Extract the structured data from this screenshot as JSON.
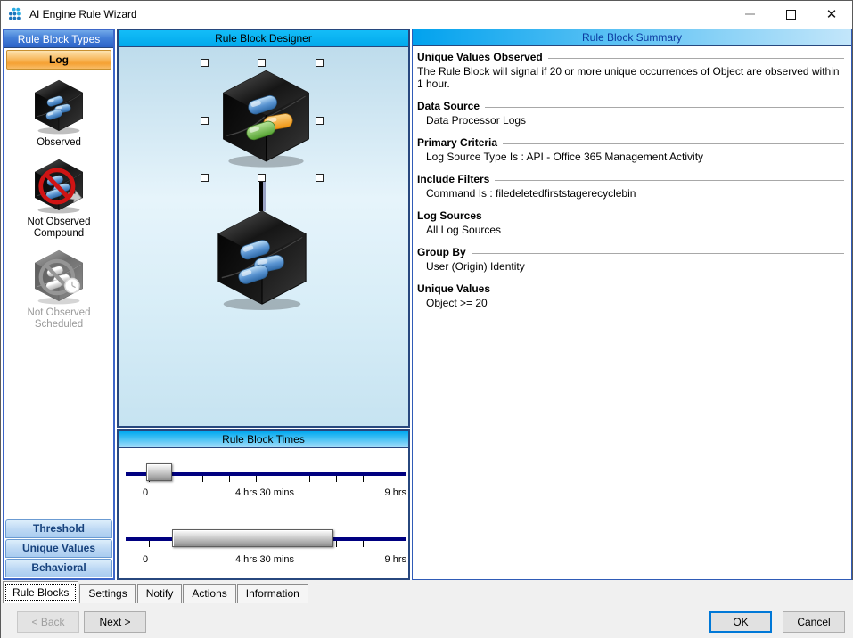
{
  "window": {
    "title": "AI Engine Rule Wizard"
  },
  "left_panel": {
    "header": "Rule Block Types",
    "log_tab": "Log",
    "items": [
      {
        "label": "Observed",
        "icon": "observed-cube-icon",
        "enabled": true
      },
      {
        "label": "Not Observed Compound",
        "icon": "not-observed-compound-cube-icon",
        "enabled": true
      },
      {
        "label": "Not Observed Scheduled",
        "icon": "not-observed-scheduled-cube-icon",
        "enabled": false
      }
    ],
    "bottom_tabs": [
      {
        "label": "Threshold"
      },
      {
        "label": "Unique Values"
      },
      {
        "label": "Behavioral"
      }
    ]
  },
  "designer": {
    "header": "Rule Block Designer"
  },
  "times": {
    "header": "Rule Block Times",
    "sliders": [
      {
        "labels": [
          "0",
          "4 hrs 30 mins",
          "9 hrs"
        ]
      },
      {
        "labels": [
          "0",
          "4 hrs 30 mins",
          "9 hrs"
        ]
      }
    ]
  },
  "summary": {
    "header": "Rule Block Summary",
    "sections": [
      {
        "title": "Unique Values Observed",
        "indent": false,
        "lines": [
          "The Rule Block will signal if 20 or more unique occurrences of Object are observed within 1 hour."
        ]
      },
      {
        "title": "Data Source",
        "indent": true,
        "lines": [
          "Data Processor Logs"
        ]
      },
      {
        "title": "Primary Criteria",
        "indent": true,
        "lines": [
          "Log Source Type Is : API - Office 365 Management Activity"
        ]
      },
      {
        "title": "Include Filters",
        "indent": true,
        "lines": [
          "Command Is : filedeletedfirststagerecyclebin"
        ]
      },
      {
        "title": "Log Sources",
        "indent": true,
        "lines": [
          "All Log Sources"
        ]
      },
      {
        "title": "Group By",
        "indent": true,
        "lines": [
          "User (Origin) Identity"
        ]
      },
      {
        "title": "Unique Values",
        "indent": true,
        "lines": [
          "Object >= 20"
        ]
      }
    ]
  },
  "tabs": [
    "Rule Blocks",
    "Settings",
    "Notify",
    "Actions",
    "Information"
  ],
  "buttons": {
    "back": "< Back",
    "next": "Next >",
    "ok": "OK",
    "cancel": "Cancel"
  },
  "colors": {
    "accent_cyan": "#02a9ec",
    "header_blue": "#2c63c8",
    "log_orange": "#f5a133",
    "slider_track_navy": "#000080",
    "ok_border_blue": "#0078d7",
    "summary_header_text": "#0b3aa0"
  }
}
